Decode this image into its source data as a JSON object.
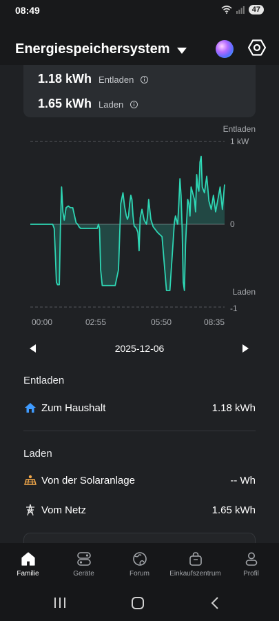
{
  "status": {
    "time": "08:49",
    "battery": "47"
  },
  "header": {
    "title": "Energiespeichersystem",
    "dropdown_icon": "caret-down-icon",
    "assistant_icon": "ai-orb-icon",
    "settings_icon": "settings-hex-icon"
  },
  "summary": {
    "discharge": {
      "value": "1.18 kWh",
      "label": "Entladen"
    },
    "charge": {
      "value": "1.65 kWh",
      "label": "Laden"
    }
  },
  "chart_data": {
    "type": "line",
    "title": "",
    "top_label": "Entladen",
    "bottom_label": "Laden",
    "y_ticks": [
      "1 kW",
      "0",
      "-1"
    ],
    "ylim": [
      -1,
      1
    ],
    "x_ticks": [
      "00:00",
      "02:55",
      "05:50",
      "08:35"
    ],
    "xlim": [
      0,
      8.7
    ],
    "series_color": "#2ed6b4",
    "series": [
      {
        "x": [
          0,
          1.0,
          1.07,
          1.12,
          1.17,
          1.22,
          1.3,
          1.35,
          1.4,
          1.46,
          1.52,
          1.6,
          1.7,
          1.8,
          1.9,
          2.0,
          2.05,
          2.12,
          2.18,
          2.25,
          2.35,
          2.6,
          3.0,
          3.05,
          3.1,
          3.15,
          3.22,
          3.4,
          3.7,
          3.8,
          3.95,
          4.05,
          4.15,
          4.22,
          4.3,
          4.35,
          4.4,
          4.45,
          4.5,
          4.55,
          4.6,
          4.65,
          4.75,
          4.82,
          4.87,
          4.92,
          5.0,
          5.1,
          5.2,
          5.25,
          5.3,
          5.4,
          5.5,
          5.7,
          5.9,
          6.1,
          6.25,
          6.3,
          6.4,
          6.45,
          6.5,
          6.55,
          6.6,
          6.65,
          6.7,
          6.75,
          6.8,
          6.85,
          6.9,
          6.95,
          7.05,
          7.1,
          7.15,
          7.2,
          7.3,
          7.35,
          7.4,
          7.45,
          7.5,
          7.55,
          7.6,
          7.65,
          7.7,
          7.8,
          7.9,
          8.0,
          8.1,
          8.2,
          8.3,
          8.4,
          8.5,
          8.6,
          8.7
        ],
        "y": [
          0,
          0,
          -0.05,
          -0.35,
          -0.7,
          -0.73,
          -0.73,
          0,
          0.45,
          0.15,
          0.05,
          0.2,
          0.22,
          0.2,
          0.2,
          0.08,
          0.02,
          0,
          -0.03,
          -0.05,
          -0.05,
          -0.05,
          -0.05,
          0,
          -0.05,
          -0.55,
          -0.74,
          -0.74,
          -0.74,
          -0.74,
          -0.55,
          0.25,
          0.38,
          0.22,
          0.1,
          0.06,
          0.1,
          0.25,
          0.35,
          0.3,
          0.1,
          -0.02,
          -0.05,
          -0.1,
          -0.32,
          0.08,
          0.18,
          0.05,
          0,
          0.1,
          0.3,
          0.06,
          -0.03,
          -0.1,
          -0.15,
          -0.8,
          -0.8,
          -0.6,
          -0.2,
          0.02,
          0.1,
          0.05,
          0,
          0.25,
          0.55,
          0.35,
          -0.05,
          -0.7,
          -0.8,
          -0.25,
          0.3,
          0.25,
          0.1,
          0.45,
          0.35,
          0.3,
          0.15,
          0.6,
          0.45,
          0.4,
          0.75,
          0.82,
          0.45,
          0.38,
          0.58,
          0.28,
          0.18,
          0.35,
          0.15,
          0.3,
          0.45,
          0.18,
          0.48
        ]
      }
    ],
    "grid": true
  },
  "date_nav": {
    "date": "2025-12-06",
    "prev_icon": "triangle-left-icon",
    "next_icon": "triangle-right-icon"
  },
  "discharge_section": {
    "title": "Entladen",
    "rows": [
      {
        "icon": "house-icon",
        "label": "Zum Haushalt",
        "value": "1.18 kWh"
      }
    ]
  },
  "charge_section": {
    "title": "Laden",
    "rows": [
      {
        "icon": "solar-panel-icon",
        "label": "Von der Solaranlage",
        "value": "-- Wh"
      },
      {
        "icon": "power-tower-icon",
        "label": "Vom Netz",
        "value": "1.65 kWh"
      }
    ]
  },
  "bottom_nav": [
    {
      "label": "Familie",
      "icon": "home-icon",
      "active": true
    },
    {
      "label": "Geräte",
      "icon": "devices-icon",
      "active": false
    },
    {
      "label": "Forum",
      "icon": "globe-icon",
      "active": false
    },
    {
      "label": "Einkaufszentrum",
      "icon": "shopping-bag-icon",
      "active": false
    },
    {
      "label": "Profil",
      "icon": "person-icon",
      "active": false
    }
  ]
}
